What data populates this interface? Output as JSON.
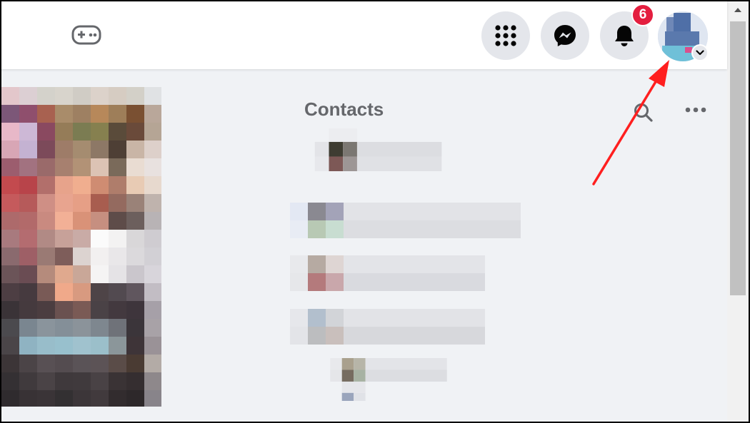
{
  "header": {
    "gaming_icon": "game-controller-icon",
    "menu_icon": "grid-menu-icon",
    "messenger_icon": "messenger-icon",
    "notifications_icon": "bell-icon",
    "notification_count": "6",
    "account_chevron_icon": "chevron-down-icon"
  },
  "contacts": {
    "title": "Contacts",
    "search_icon": "search-icon",
    "more_icon": "more-options-icon",
    "items": [
      "",
      "",
      "",
      "",
      ""
    ]
  },
  "colors": {
    "badge": "#e41e3f",
    "annotation_arrow": "#ff1f1f",
    "page_background": "#f0f2f5"
  }
}
